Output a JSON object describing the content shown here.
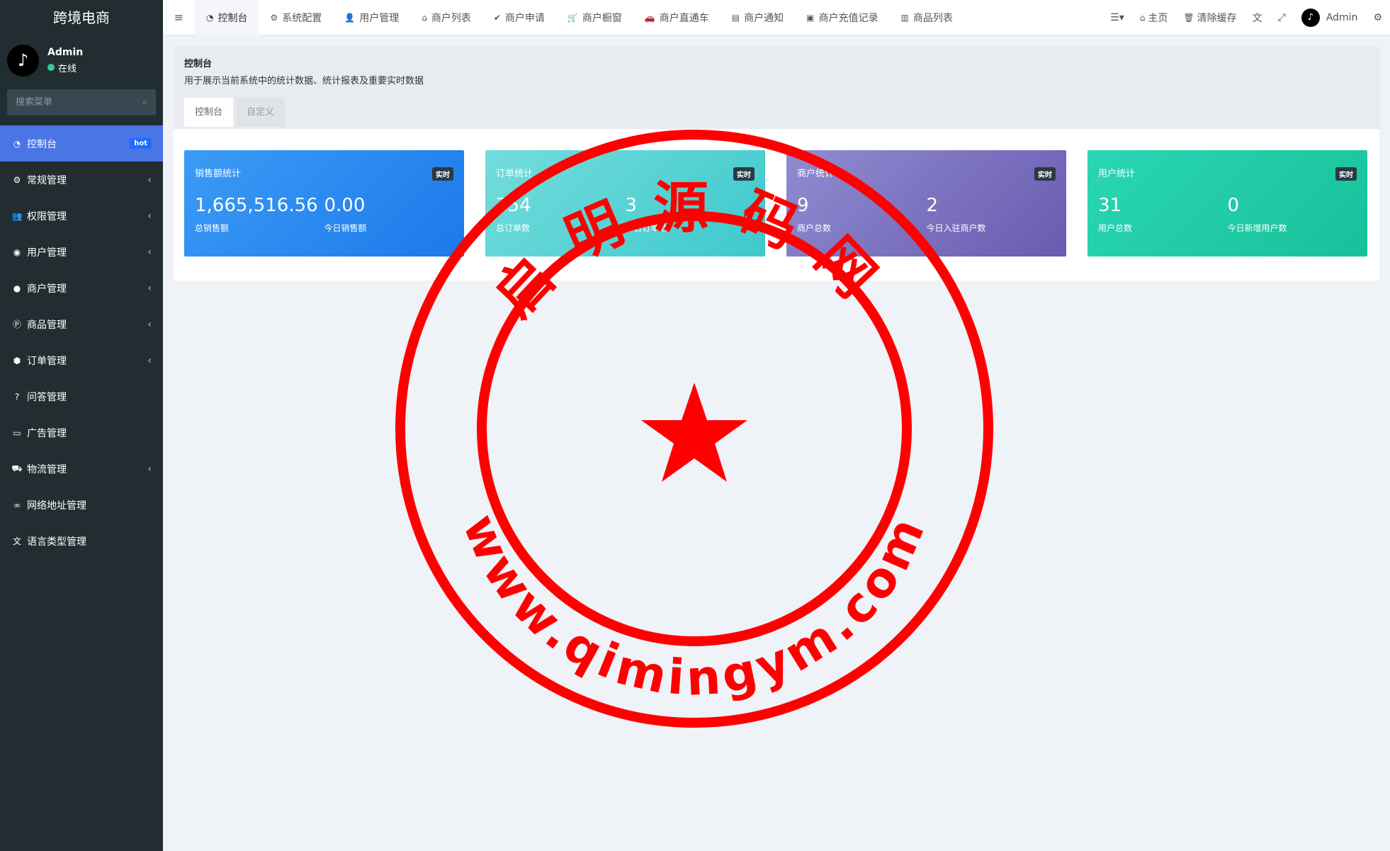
{
  "app": {
    "title": "跨境电商"
  },
  "user": {
    "name": "Admin",
    "status": "在线",
    "avatar_glyph": "♪"
  },
  "search": {
    "placeholder": "搜索菜单"
  },
  "sidebar": {
    "items": [
      {
        "label": "控制台",
        "icon": "dashboard-icon",
        "glyph": "◔",
        "badge": "hot",
        "active": true
      },
      {
        "label": "常规管理",
        "icon": "cogs-icon",
        "glyph": "⚙",
        "chevron": "‹"
      },
      {
        "label": "权限管理",
        "icon": "group-icon",
        "glyph": "👥",
        "chevron": "‹"
      },
      {
        "label": "用户管理",
        "icon": "user-circle-icon",
        "glyph": "◉",
        "chevron": "‹"
      },
      {
        "label": "商户管理",
        "icon": "apple-icon",
        "glyph": "●",
        "chevron": "‹"
      },
      {
        "label": "商品管理",
        "icon": "product-icon",
        "glyph": "Ⓟ",
        "chevron": "‹"
      },
      {
        "label": "订单管理",
        "icon": "cube-icon",
        "glyph": "⬢",
        "chevron": "‹"
      },
      {
        "label": "问答管理",
        "icon": "question-icon",
        "glyph": "?"
      },
      {
        "label": "广告管理",
        "icon": "ad-icon",
        "glyph": "▭"
      },
      {
        "label": "物流管理",
        "icon": "truck-icon",
        "glyph": "⛟",
        "chevron": "‹"
      },
      {
        "label": "网络地址管理",
        "icon": "link-icon",
        "glyph": "∞"
      },
      {
        "label": "语言类型管理",
        "icon": "language-icon",
        "glyph": "文"
      }
    ]
  },
  "topnav": {
    "toggle_glyph": "≡",
    "tabs": [
      {
        "label": "控制台",
        "icon": "dashboard-icon",
        "glyph": "◔",
        "active": true
      },
      {
        "label": "系统配置",
        "icon": "cog-icon",
        "glyph": "⚙"
      },
      {
        "label": "用户管理",
        "icon": "user-icon",
        "glyph": "👤"
      },
      {
        "label": "商户列表",
        "icon": "home-icon",
        "glyph": "⌂"
      },
      {
        "label": "商户申请",
        "icon": "check-circle-icon",
        "glyph": "✔"
      },
      {
        "label": "商户橱窗",
        "icon": "cart-icon",
        "glyph": "🛒"
      },
      {
        "label": "商户直通车",
        "icon": "car-icon",
        "glyph": "🚗"
      },
      {
        "label": "商户通知",
        "icon": "notice-icon",
        "glyph": "▤"
      },
      {
        "label": "商户充值记录",
        "icon": "money-icon",
        "glyph": "▣"
      },
      {
        "label": "商品列表",
        "icon": "shop-icon",
        "glyph": "▥"
      }
    ],
    "right": {
      "list_glyph": "☰▾",
      "home_label": "主页",
      "home_glyph": "⌂",
      "clear_label": "清除缓存",
      "clear_glyph": "🗑",
      "lang_glyph": "文",
      "fullscreen_glyph": "⤢",
      "admin_label": "Admin",
      "settings_glyph": "⚙"
    }
  },
  "panel": {
    "title": "控制台",
    "description": "用于展示当前系统中的统计数据、统计报表及重要实时数据",
    "tabs": [
      "控制台",
      "自定义"
    ]
  },
  "cards": [
    {
      "title": "销售额统计",
      "badge": "实时",
      "left_value": "1,665,516.56",
      "left_label": "总销售额",
      "right_value": "0.00",
      "right_label": "今日销售额",
      "color": "#1b79eb"
    },
    {
      "title": "订单统计",
      "badge": "实时",
      "left_value": "754",
      "left_label": "总订单数",
      "right_value": "3",
      "right_label": "今日订单数",
      "color": "#3ec9cc"
    },
    {
      "title": "商户统计",
      "badge": "实时",
      "left_value": "9",
      "left_label": "商户总数",
      "right_value": "2",
      "right_label": "今日入驻商户数",
      "color": "#6a5ab0"
    },
    {
      "title": "用户统计",
      "badge": "实时",
      "left_value": "31",
      "left_label": "用户总数",
      "right_value": "0",
      "right_label": "今日新增用户数",
      "color": "#16c19a"
    }
  ],
  "stamp": {
    "top_text": "启明源码网",
    "bottom_text": "www.qimingym.com",
    "color": "#ff0000"
  }
}
